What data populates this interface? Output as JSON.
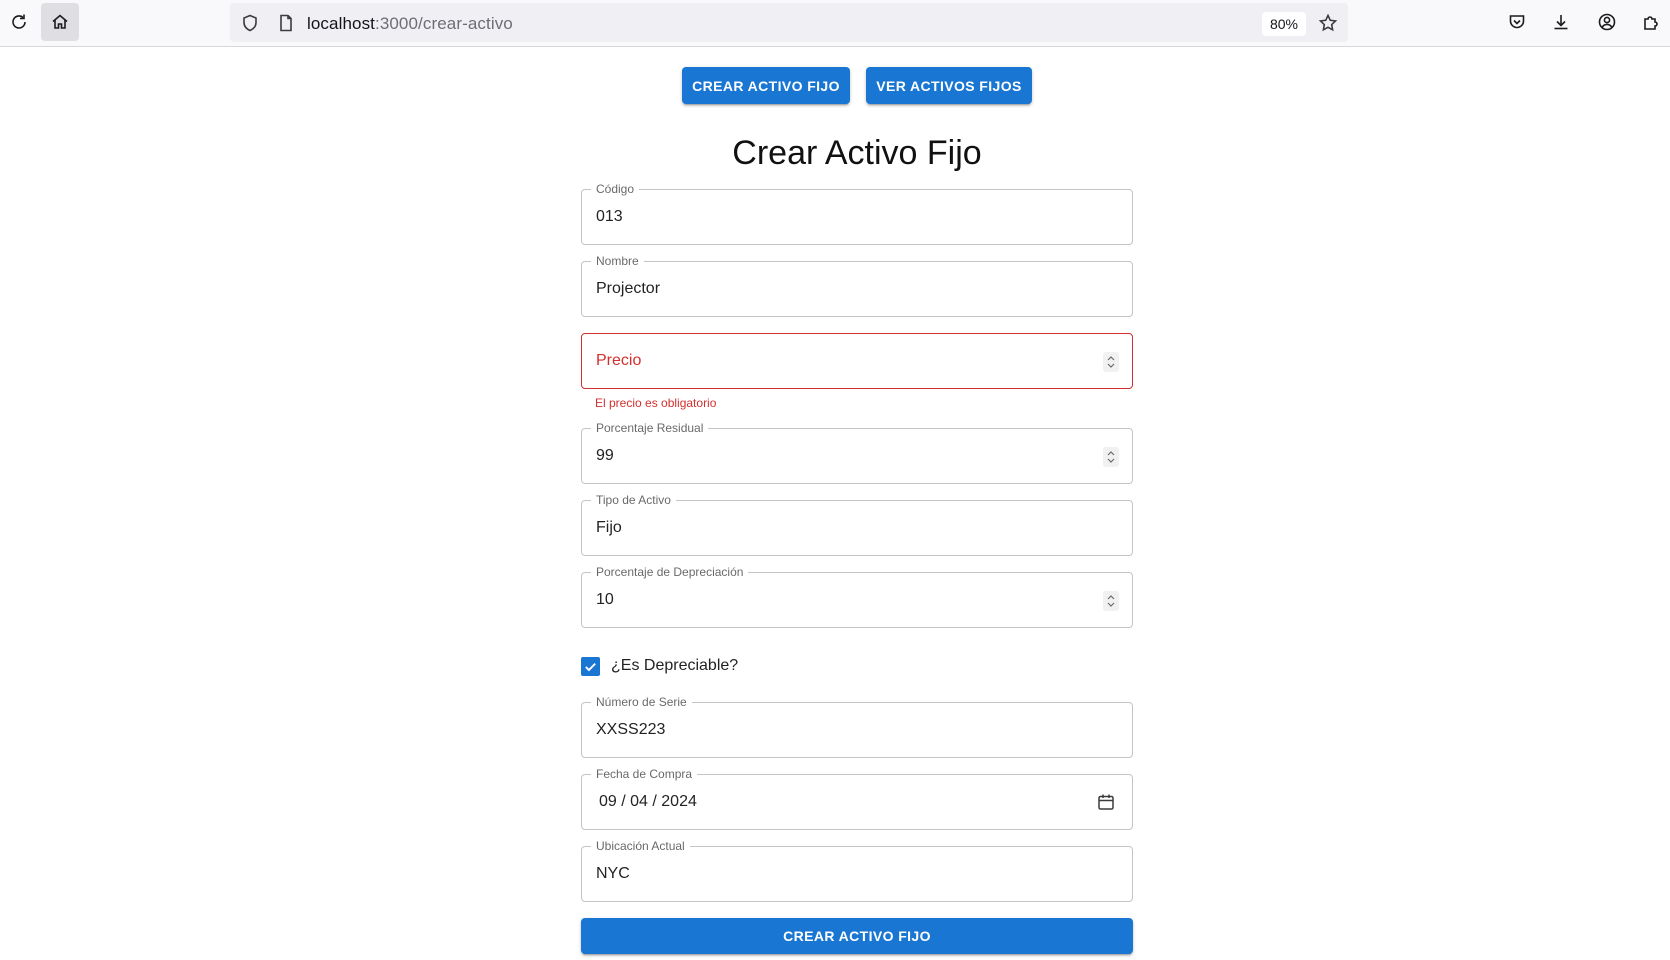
{
  "browser": {
    "url_host": "localhost",
    "url_path": ":3000/crear-activo",
    "zoom": "80%",
    "icons": [
      "reload-icon",
      "home-icon",
      "shield-icon",
      "page-icon",
      "bookmark-star-icon",
      "pocket-icon",
      "download-icon",
      "account-icon",
      "extensions-icon"
    ]
  },
  "nav": {
    "create_label": "CREAR ACTIVO FIJO",
    "list_label": "VER ACTIVOS FIJOS"
  },
  "form": {
    "title": "Crear Activo Fijo",
    "codigo": {
      "label": "Código",
      "value": "013"
    },
    "nombre": {
      "label": "Nombre",
      "value": "Projector"
    },
    "precio": {
      "label": "Precio",
      "value": "",
      "error": "El precio es obligatorio"
    },
    "porcentaje_residual": {
      "label": "Porcentaje Residual",
      "value": "99"
    },
    "tipo_activo": {
      "label": "Tipo de Activo",
      "value": "Fijo"
    },
    "porcentaje_depreciacion": {
      "label": "Porcentaje de Depreciación",
      "value": "10"
    },
    "es_depreciable": {
      "label": "¿Es Depreciable?",
      "checked": true
    },
    "numero_serie": {
      "label": "Número de Serie",
      "value": "XXSS223"
    },
    "fecha_compra": {
      "label": "Fecha de Compra",
      "value": "09 / 04 / 2024"
    },
    "ubicacion_actual": {
      "label": "Ubicación Actual",
      "value": "NYC"
    },
    "submit_label": "CREAR ACTIVO FIJO"
  },
  "colors": {
    "primary": "#1976d2",
    "error": "#d32f2f",
    "border": "#c4c4c4"
  }
}
